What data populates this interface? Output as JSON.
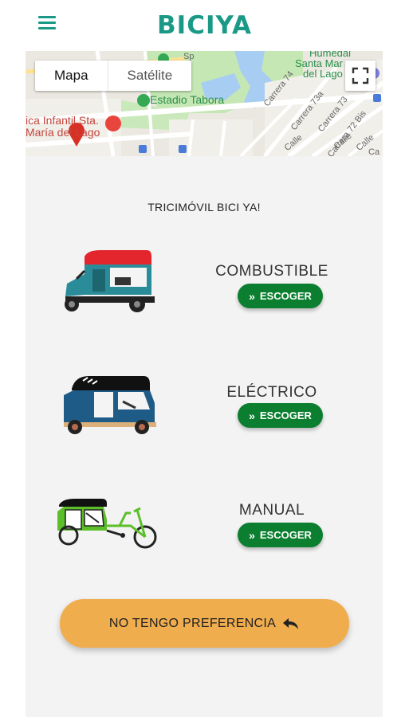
{
  "app": {
    "title": "BICIYA",
    "menu_icon": "hamburger-menu-icon",
    "brand_color": "#1a9a86"
  },
  "map": {
    "view_options": [
      "Mapa",
      "Satélite"
    ],
    "selected_view": "Mapa",
    "fullscreen_icon": "fullscreen-icon",
    "labels": {
      "estadio": "Estadio Tabora",
      "clinica_line1": "ica Infantil Sta.",
      "clinica_line2": "María del Lago",
      "humedal_line1": "Humedal",
      "humedal_line2": "Santa Mar",
      "humedal_line3": "del Lago",
      "carrera74": "Carrera 74",
      "carrera73a": "Carrera 73a",
      "carrera73": "Carrera 73",
      "carrera72bis": "Carrera 72 Bis",
      "calle1": "Calle",
      "calle2": "Calle",
      "calle3": "Calle",
      "ca": "Ca",
      "sp": "Sp"
    }
  },
  "main": {
    "headline": "TRICIMÓVIL BICI YA!",
    "options": [
      {
        "title": "COMBUSTIBLE",
        "button_label": "ESCOGER",
        "image": "fuel-tuk-tuk-icon"
      },
      {
        "title": "ELÉCTRICO",
        "button_label": "ESCOGER",
        "image": "electric-tuk-tuk-icon"
      },
      {
        "title": "MANUAL",
        "button_label": "ESCOGER",
        "image": "pedal-tricycle-icon"
      }
    ],
    "no_preference_label": "NO TENGO PREFERENCIA",
    "no_preference_icon": "reply-arrow-icon",
    "colors": {
      "choose_button": "#0b7f2f",
      "no_preference_button": "#f0ad4e"
    }
  }
}
